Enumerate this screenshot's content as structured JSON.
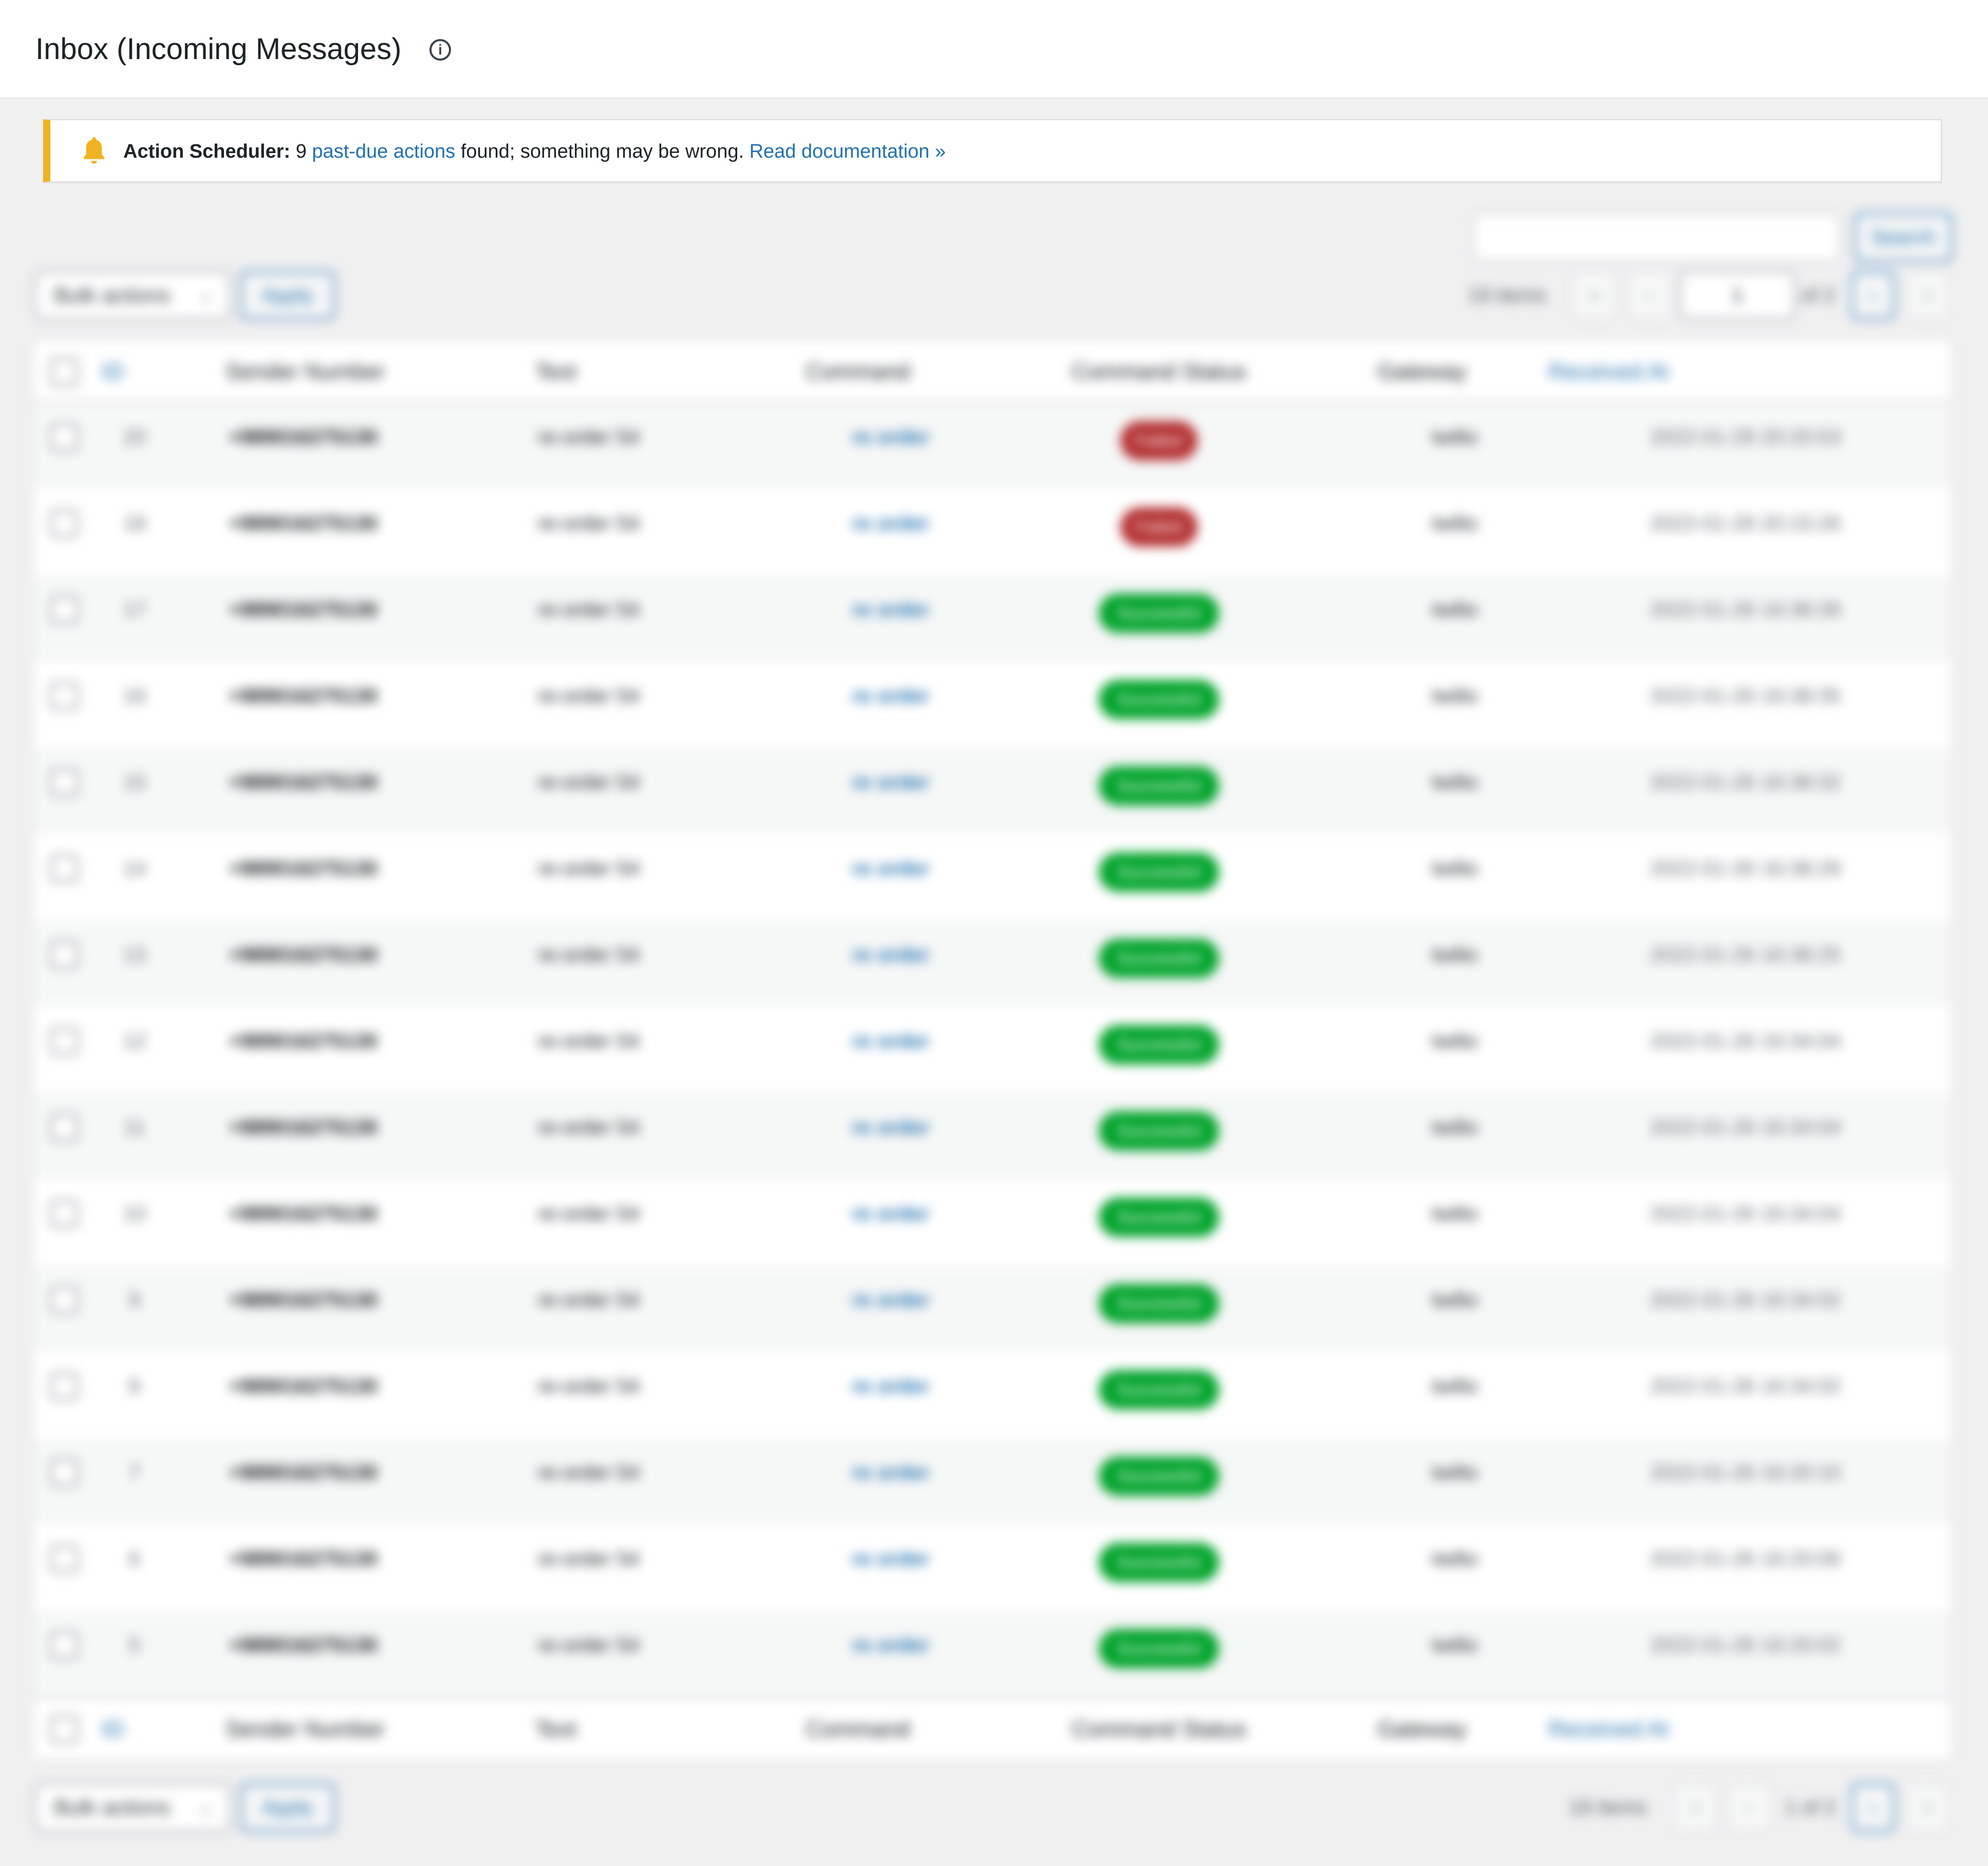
{
  "header": {
    "title": "Inbox (Incoming Messages)",
    "info_icon": "ⓘ"
  },
  "notice": {
    "icon": "bell-icon",
    "label": "Action Scheduler:",
    "count": "9",
    "link_text": "past-due actions",
    "message": "found; something may be wrong.",
    "doc_link": "Read documentation »",
    "accent_color": "#f0b322"
  },
  "search": {
    "value": "",
    "button_label": "Search"
  },
  "top_nav": {
    "bulk_label": "Bulk actions",
    "apply_label": "Apply",
    "items_count": "19 items",
    "first": "«",
    "prev": "‹",
    "current_page": "1",
    "of_total": "of 2",
    "next": "›",
    "last": "»"
  },
  "bottom_nav": {
    "bulk_label": "Bulk actions",
    "apply_label": "Apply",
    "items_count": "19 items",
    "first": "«",
    "prev": "‹",
    "page_text": "1 of 2",
    "next": "›",
    "last": "»"
  },
  "columns": {
    "id": "ID",
    "sender": "Sender Number",
    "text": "Text",
    "command": "Command",
    "status": "Command Status",
    "gateway": "Gateway",
    "received": "Received At"
  },
  "status_colors": {
    "Failed": "#b32d2e",
    "Successful": "#00a32a"
  },
  "rows": [
    {
      "id": "20",
      "sender": "+989016275130",
      "text": "re-order 54",
      "command": "re order",
      "status": "Failed",
      "gateway": "twilio",
      "received": "2022-01-29 20:20:53"
    },
    {
      "id": "18",
      "sender": "+989016275130",
      "text": "re-order 54",
      "command": "re order",
      "status": "Failed",
      "gateway": "twilio",
      "received": "2022-01-29 20:15:26"
    },
    {
      "id": "17",
      "sender": "+989016275130",
      "text": "re-order 54",
      "command": "re order",
      "status": "Successful",
      "gateway": "twilio",
      "received": "2022-01-26 16:38:39"
    },
    {
      "id": "16",
      "sender": "+989016275130",
      "text": "re-order 54",
      "command": "re order",
      "status": "Successful",
      "gateway": "twilio",
      "received": "2022-01-26 16:38:35"
    },
    {
      "id": "15",
      "sender": "+989016275130",
      "text": "re-order 54",
      "command": "re order",
      "status": "Successful",
      "gateway": "twilio",
      "received": "2022-01-26 16:38:32"
    },
    {
      "id": "14",
      "sender": "+989016275130",
      "text": "re-order 54",
      "command": "re order",
      "status": "Successful",
      "gateway": "twilio",
      "received": "2022-01-26 16:38:29"
    },
    {
      "id": "13",
      "sender": "+989016275130",
      "text": "re-order 54",
      "command": "re order",
      "status": "Successful",
      "gateway": "twilio",
      "received": "2022-01-26 16:38:25"
    },
    {
      "id": "12",
      "sender": "+989016275130",
      "text": "re-order 54",
      "command": "re order",
      "status": "Successful",
      "gateway": "twilio",
      "received": "2022-01-26 16:34:04"
    },
    {
      "id": "11",
      "sender": "+989016275130",
      "text": "re-order 54",
      "command": "re order",
      "status": "Successful",
      "gateway": "twilio",
      "received": "2022-01-26 16:34:04"
    },
    {
      "id": "10",
      "sender": "+989016275130",
      "text": "re-order 54",
      "command": "re order",
      "status": "Successful",
      "gateway": "twilio",
      "received": "2022-01-26 16:34:04"
    },
    {
      "id": "9",
      "sender": "+989016275130",
      "text": "re-order 54",
      "command": "re order",
      "status": "Successful",
      "gateway": "twilio",
      "received": "2022-01-26 16:34:02"
    },
    {
      "id": "8",
      "sender": "+989016275130",
      "text": "re-order 54",
      "command": "re order",
      "status": "Successful",
      "gateway": "twilio",
      "received": "2022-01-26 16:34:02"
    },
    {
      "id": "7",
      "sender": "+989016275130",
      "text": "re-order 54",
      "command": "re order",
      "status": "Successful",
      "gateway": "twilio",
      "received": "2022-01-26 16:20:10"
    },
    {
      "id": "6",
      "sender": "+989016275130",
      "text": "re-order 54",
      "command": "re order",
      "status": "Successful",
      "gateway": "twilio",
      "received": "2022-01-26 16:20:06"
    },
    {
      "id": "5",
      "sender": "+989016275130",
      "text": "re-order 54",
      "command": "re order",
      "status": "Successful",
      "gateway": "twilio",
      "received": "2022-01-26 16:20:02"
    }
  ]
}
